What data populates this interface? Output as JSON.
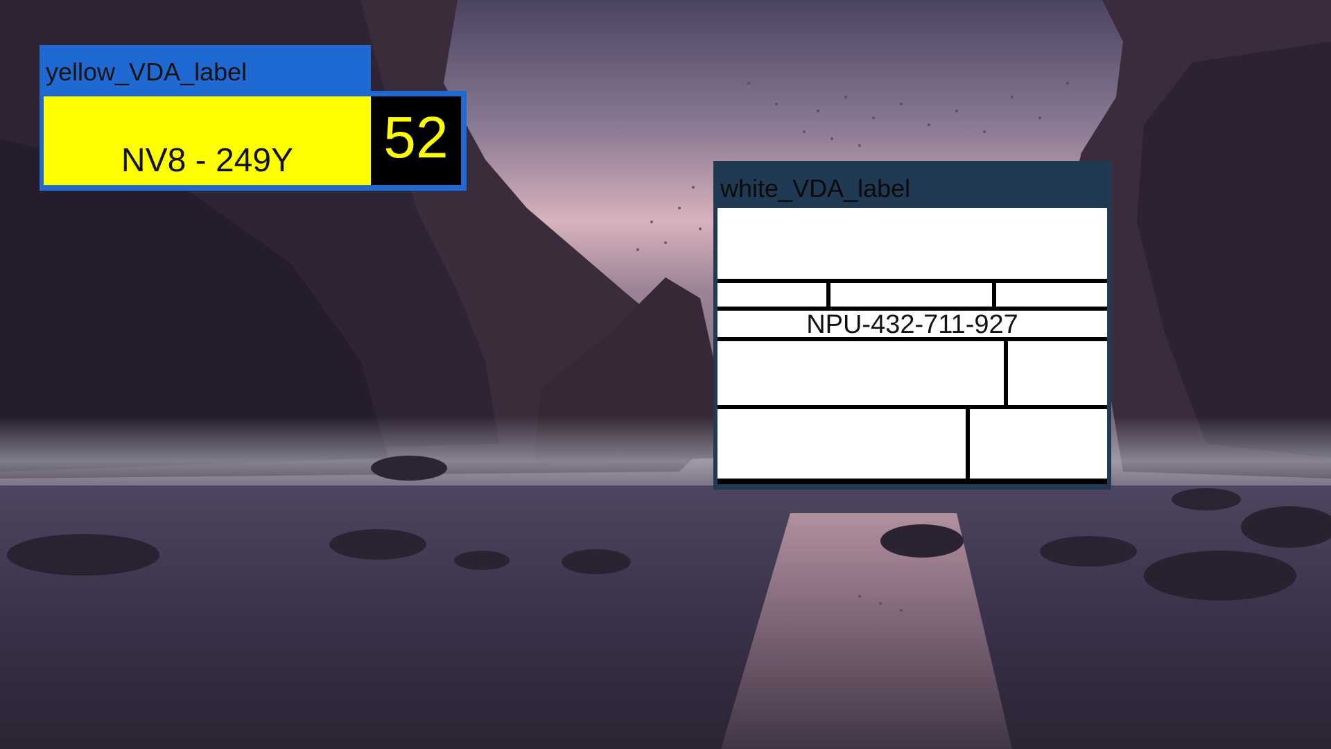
{
  "yellow_label": {
    "title": "yellow_VDA_label",
    "plate_text": "NV8 - 249Y",
    "number": "52",
    "colors": {
      "frame": "#1e6ad2",
      "plate": "#ffff00",
      "number_box": "#000000",
      "number_text": "#ffff00"
    }
  },
  "white_label": {
    "title": "white_VDA_label",
    "code": "NPU-432-711-927",
    "colors": {
      "frame": "#1f3a52",
      "cells": "#ffffff",
      "lines": "#000000"
    }
  },
  "wallpaper": {
    "description_icon": "landscape-wallpaper"
  }
}
